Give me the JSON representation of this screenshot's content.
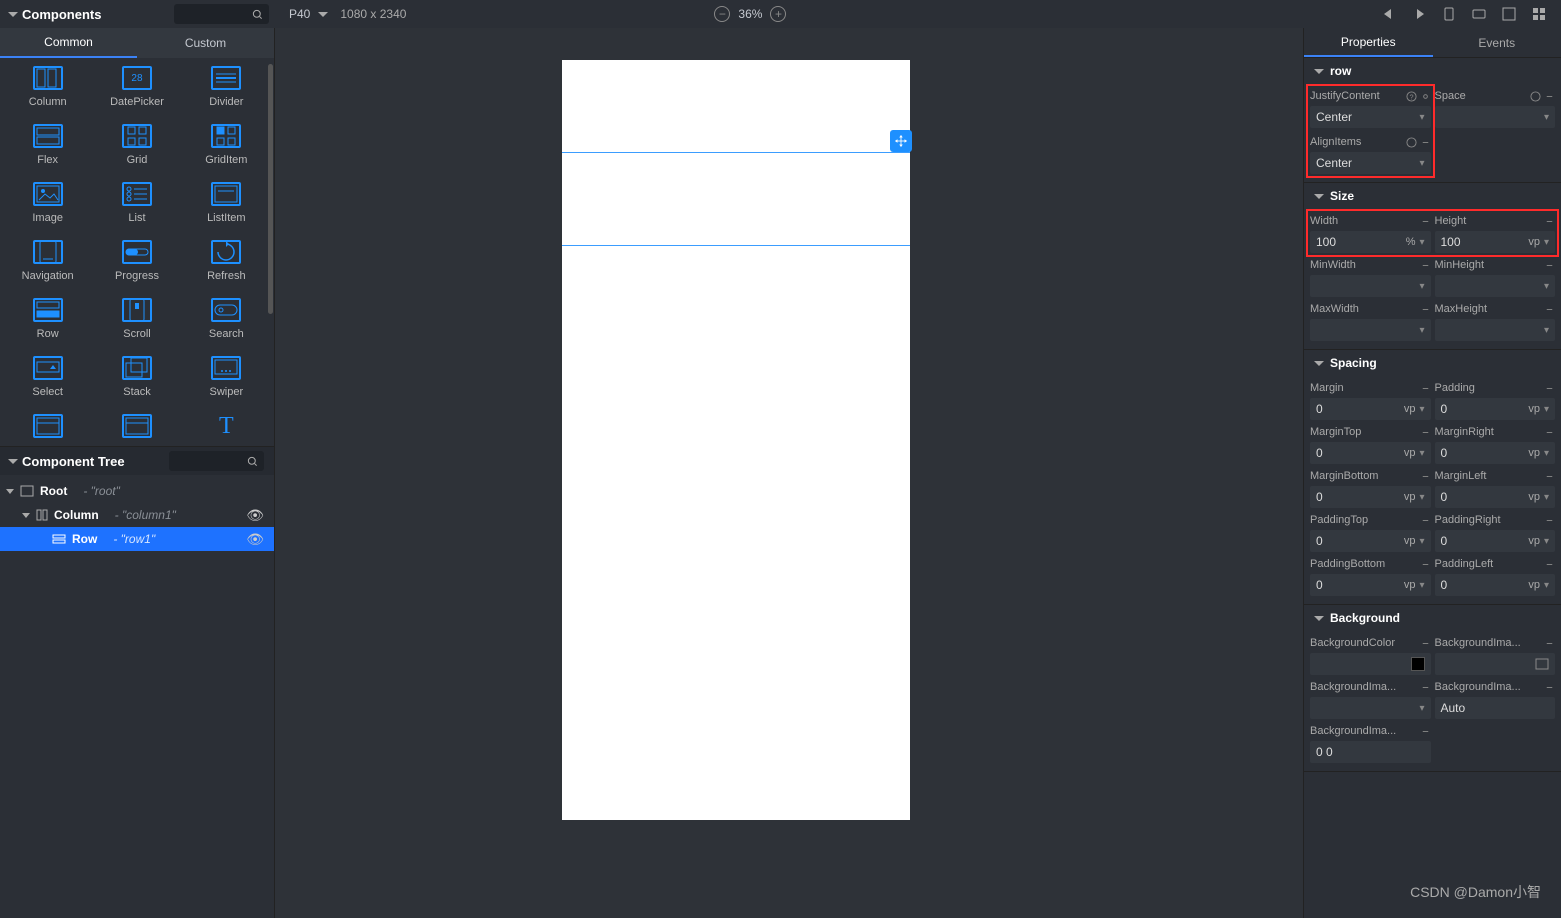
{
  "topbar": {
    "panel_label": "Components",
    "device": "P40",
    "resolution": "1080 x 2340",
    "zoom": "36%"
  },
  "tabs": {
    "common": "Common",
    "custom": "Custom"
  },
  "components": {
    "c0": "Column",
    "c1": "DatePicker",
    "c2": "Divider",
    "c3": "Flex",
    "c4": "Grid",
    "c5": "GridItem",
    "c6": "Image",
    "c7": "List",
    "c8": "ListItem",
    "c9": "Navigation",
    "c10": "Progress",
    "c11": "Refresh",
    "c12": "Row",
    "c13": "Scroll",
    "c14": "Search",
    "c15": "Select",
    "c16": "Stack",
    "c17": "Swiper"
  },
  "tree": {
    "title": "Component Tree",
    "root": {
      "label": "Root",
      "desc": "- \"root\""
    },
    "col": {
      "label": "Column",
      "desc": "- \"column1\""
    },
    "row": {
      "label": "Row",
      "desc": "- \"row1\""
    }
  },
  "props_tabs": {
    "properties": "Properties",
    "events": "Events"
  },
  "sections": {
    "row": "row",
    "size": "Size",
    "spacing": "Spacing",
    "background": "Background"
  },
  "labels": {
    "justify": "JustifyContent",
    "align": "AlignItems",
    "space": "Space",
    "width": "Width",
    "height": "Height",
    "minw": "MinWidth",
    "minh": "MinHeight",
    "maxw": "MaxWidth",
    "maxh": "MaxHeight",
    "margin": "Margin",
    "padding": "Padding",
    "mt": "MarginTop",
    "mr": "MarginRight",
    "mb": "MarginBottom",
    "ml": "MarginLeft",
    "pt": "PaddingTop",
    "pr": "PaddingRight",
    "pb": "PaddingBottom",
    "pl": "PaddingLeft",
    "bgc": "BackgroundColor",
    "bgi": "BackgroundIma...",
    "bgi2": "BackgroundIma...",
    "bgi3": "BackgroundIma...",
    "bgi4": "BackgroundIma..."
  },
  "values": {
    "center": "Center",
    "auto": "Auto",
    "zero": "0",
    "hundred": "100",
    "zerozero": "0 0"
  },
  "units": {
    "pct": "%",
    "vp": "vp"
  },
  "watermark": "CSDN @Damon小智"
}
